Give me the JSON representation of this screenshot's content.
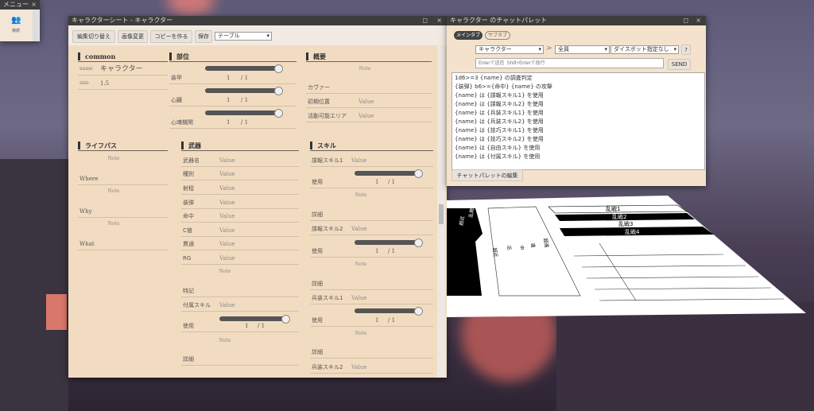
{
  "menu": {
    "title": "メニュー",
    "item": "接続"
  },
  "sheet": {
    "title": "キャラクターシート - キャラクター",
    "toolbar": {
      "edit_toggle": "編集切り替え",
      "change_image": "画像変更",
      "make_copy": "コピーを作る",
      "save": "保存",
      "select_value": "テーブル"
    },
    "common": {
      "header": "common",
      "name_label": "name",
      "name_value": "キャラクター",
      "size_label": "size",
      "size_value": "1.5"
    },
    "parts": {
      "header": "部位",
      "items": [
        {
          "label": "装甲",
          "value": "1",
          "max": "/ 1"
        },
        {
          "label": "心臓",
          "value": "1",
          "max": "/ 1"
        },
        {
          "label": "心魂機関",
          "value": "1",
          "max": "/ 1"
        }
      ]
    },
    "overview": {
      "header": "概要",
      "note": "Note",
      "cover": "カヴァー",
      "initial_pos": "初期位置",
      "initial_pos_value": "Value",
      "area": "活動可能エリア",
      "area_value": "Value"
    },
    "lifepath": {
      "header": "ライフパス",
      "note": "Note",
      "where": "Where",
      "why": "Why",
      "what": "What"
    },
    "weapon": {
      "header": "武器",
      "fields": [
        {
          "label": "武器名",
          "value": "Value"
        },
        {
          "label": "種別",
          "value": "Value"
        },
        {
          "label": "射程",
          "value": "Value"
        },
        {
          "label": "装弾",
          "value": "Value"
        },
        {
          "label": "命中",
          "value": "Value"
        },
        {
          "label": "C値",
          "value": "Value"
        },
        {
          "label": "貫通",
          "value": "Value"
        },
        {
          "label": "RG",
          "value": "Value"
        }
      ],
      "note": "Note",
      "special": "特記",
      "attached_skill": "付属スキル",
      "attached_value": "Value",
      "use": "使用",
      "use_value": "1",
      "use_max": "/ 1",
      "detail": "詳細"
    },
    "skills": {
      "header": "スキル",
      "items": [
        {
          "name": "諜報スキル1",
          "value": "Value"
        },
        {
          "name": "諜報スキル2",
          "value": "Value"
        },
        {
          "name": "兵装スキル1",
          "value": "Value"
        },
        {
          "name": "兵装スキル2",
          "value": "Value"
        }
      ],
      "use": "使用",
      "use_value": "1",
      "use_max": "/ 1",
      "note": "Note",
      "detail": "詳細"
    }
  },
  "palette": {
    "title": "キャラクター のチャットパレット",
    "tabs": [
      "メインタブ",
      "サブタブ"
    ],
    "character_select": "キャラクター",
    "target_select": "全員",
    "dicebot_select": "ダイスボット指定なし",
    "help": "?",
    "arrow": ">",
    "input_placeholder": "Enterで送信  Shift+Enterで改行",
    "send": "SEND",
    "lines": [
      "1d6>=3 {name} の調査判定",
      "{装弾} b6>={命中} {name} の攻撃",
      "{name} は {諜報スキル1} を使用",
      "{name} は {諜報スキル2} を使用",
      "{name} は {兵装スキル1} を使用",
      "{name} は {兵装スキル2} を使用",
      "{name} は {技巧スキル1} を使用",
      "{name} は {技巧スキル2} を使用",
      "{name} は {自由スキル} を使用",
      "{name} は {付属スキル} を使用"
    ],
    "edit_button": "チャットパレットの編集"
  },
  "card": {
    "rows": [
      "乱戦1",
      "乱戦2",
      "乱戦3",
      "乱戦4"
    ],
    "ranges": [
      "超近",
      "近",
      "中",
      "遠",
      "超遠"
    ],
    "left": [
      "超近",
      "乱戦"
    ],
    "label": "乱戦"
  }
}
